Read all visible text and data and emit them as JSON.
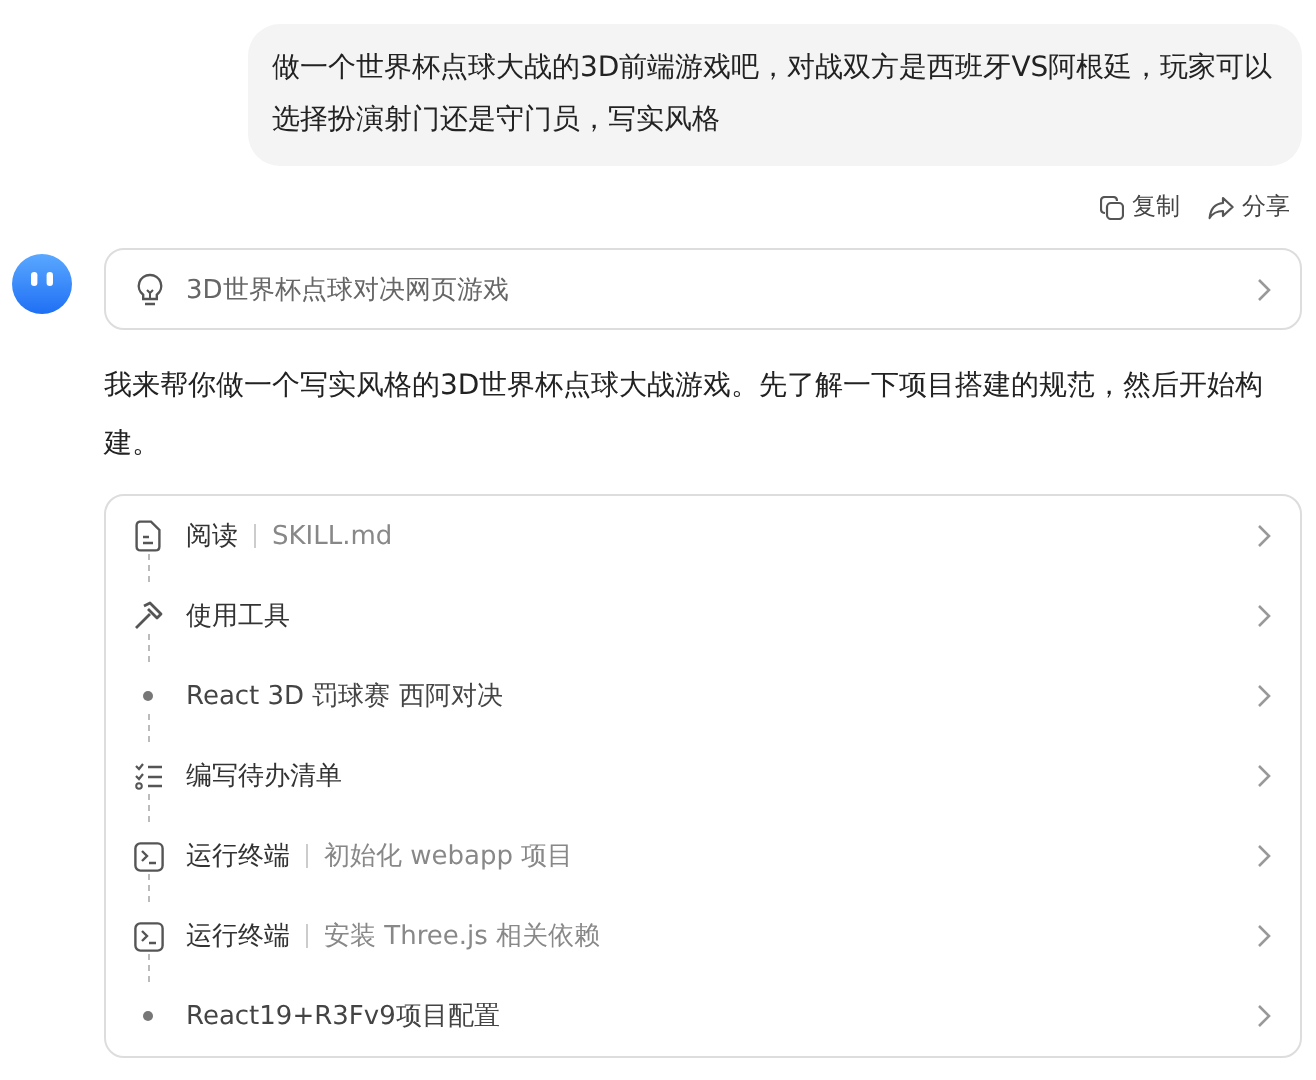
{
  "user_message": "做一个世界杯点球大战的3D前端游戏吧，对战双方是西班牙VS阿根廷，玩家可以选择扮演射门还是守门员，写实风格",
  "message_actions": [
    {
      "kind": "copy",
      "label": "复制"
    },
    {
      "kind": "share",
      "label": "分享"
    }
  ],
  "suggestion": {
    "text": "3D世界杯点球对决网页游戏"
  },
  "reply": "我来帮你做一个写实风格的3D世界杯点球大战游戏。先了解一下项目搭建的规范，然后开始构建。",
  "steps": [
    {
      "kind": "doc",
      "label": "阅读",
      "detail": "SKILL.md"
    },
    {
      "kind": "tool",
      "label": "使用工具"
    },
    {
      "kind": "dot",
      "label": "React 3D 罚球赛 西阿对决"
    },
    {
      "kind": "todo",
      "label": "编写待办清单"
    },
    {
      "kind": "terminal",
      "label": "运行终端",
      "detail": "初始化 webapp 项目"
    },
    {
      "kind": "terminal",
      "label": "运行终端",
      "detail": "安装 Three.js 相关依赖"
    },
    {
      "kind": "dot",
      "label": "React19+R3Fv9项目配置"
    }
  ]
}
